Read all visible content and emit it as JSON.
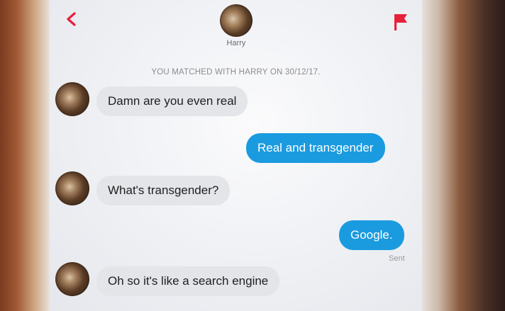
{
  "header": {
    "name": "Harry",
    "icons": {
      "back": "chevron-left-icon",
      "report": "flag-icon"
    },
    "flag_color": "#e8203b",
    "back_color": "#e8203b"
  },
  "match_notice": "YOU MATCHED WITH HARRY ON 30/12/17.",
  "messages": [
    {
      "from": "them",
      "text": "Damn are you even real"
    },
    {
      "from": "me",
      "text": "Real and transgender"
    },
    {
      "from": "them",
      "text": "What's transgender?"
    },
    {
      "from": "me",
      "text": "Google.",
      "status": "Sent"
    },
    {
      "from": "them",
      "text": "Oh so it's like a search engine"
    }
  ],
  "colors": {
    "outgoing_bubble": "#1a9be0",
    "incoming_bubble": "#e3e5e9"
  }
}
